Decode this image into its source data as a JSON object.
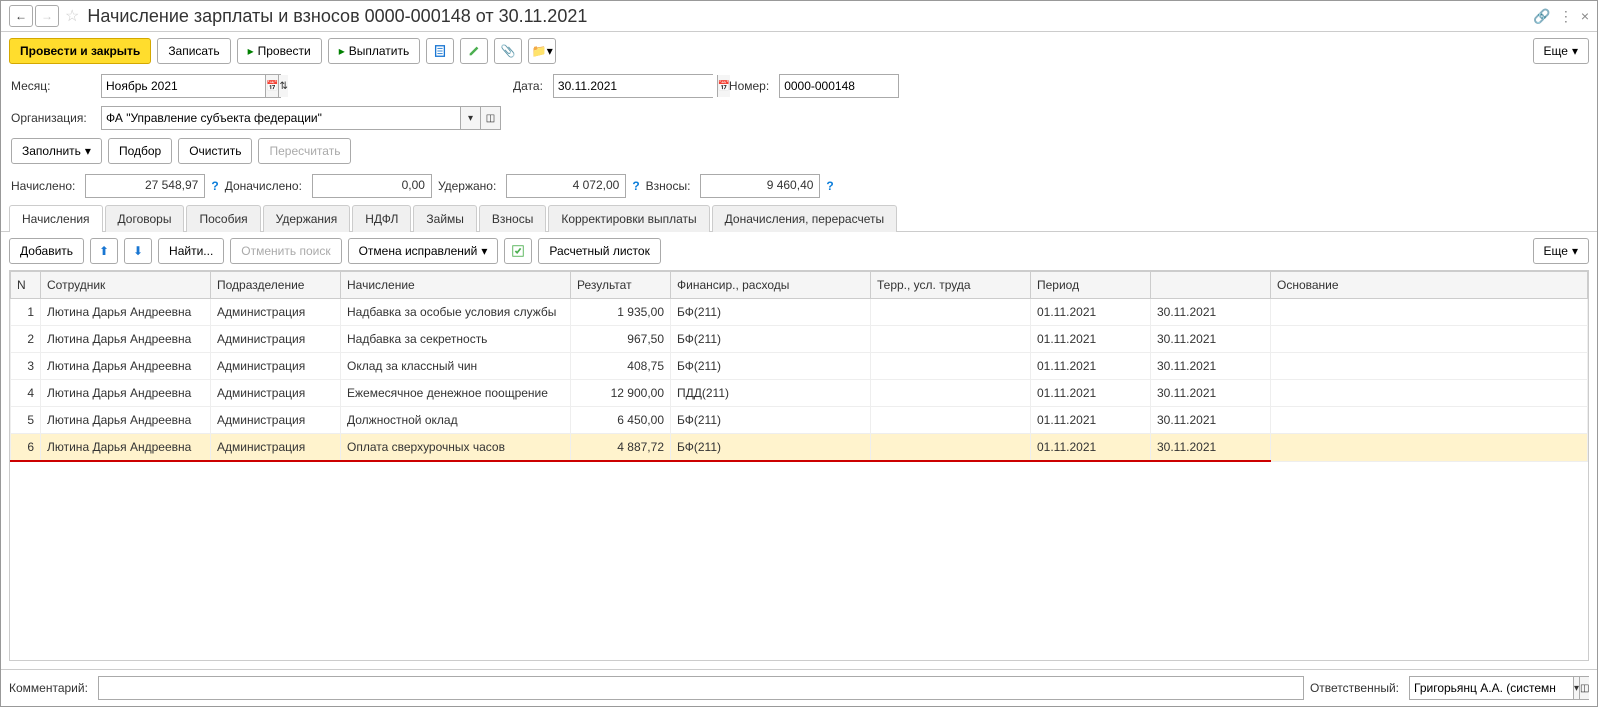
{
  "title": "Начисление зарплаты и взносов 0000-000148 от 30.11.2021",
  "toolbar": {
    "post_close": "Провести и закрыть",
    "save": "Записать",
    "post": "Провести",
    "pay": "Выплатить",
    "more": "Еще"
  },
  "form": {
    "month_label": "Месяц:",
    "month_value": "Ноябрь 2021",
    "date_label": "Дата:",
    "date_value": "30.11.2021",
    "number_label": "Номер:",
    "number_value": "0000-000148",
    "org_label": "Организация:",
    "org_value": "ФА \"Управление субъекта федерации\""
  },
  "actions": {
    "fill": "Заполнить",
    "pick": "Подбор",
    "clear": "Очистить",
    "recalc": "Пересчитать"
  },
  "summary": {
    "accrued_label": "Начислено:",
    "accrued_value": "27 548,97",
    "extra_label": "Доначислено:",
    "extra_value": "0,00",
    "withheld_label": "Удержано:",
    "withheld_value": "4 072,00",
    "contrib_label": "Взносы:",
    "contrib_value": "9 460,40"
  },
  "tabs": [
    "Начисления",
    "Договоры",
    "Пособия",
    "Удержания",
    "НДФЛ",
    "Займы",
    "Взносы",
    "Корректировки выплаты",
    "Доначисления, перерасчеты"
  ],
  "tab_toolbar": {
    "add": "Добавить",
    "find": "Найти...",
    "cancel_search": "Отменить поиск",
    "cancel_fixes": "Отмена исправлений",
    "payslip": "Расчетный листок",
    "more": "Еще"
  },
  "columns": [
    "N",
    "Сотрудник",
    "Подразделение",
    "Начисление",
    "Результат",
    "Финансир., расходы",
    "Терр., усл. труда",
    "Период",
    "",
    "Основание"
  ],
  "rows": [
    {
      "n": "1",
      "emp": "Лютина Дарья Андреевна",
      "dept": "Администрация",
      "accr": "Надбавка за особые условия службы",
      "res": "1 935,00",
      "fin": "БФ(211)",
      "terr": "",
      "p1": "01.11.2021",
      "p2": "30.11.2021",
      "base": ""
    },
    {
      "n": "2",
      "emp": "Лютина Дарья Андреевна",
      "dept": "Администрация",
      "accr": "Надбавка за секретность",
      "res": "967,50",
      "fin": "БФ(211)",
      "terr": "",
      "p1": "01.11.2021",
      "p2": "30.11.2021",
      "base": ""
    },
    {
      "n": "3",
      "emp": "Лютина Дарья Андреевна",
      "dept": "Администрация",
      "accr": "Оклад за классный чин",
      "res": "408,75",
      "fin": "БФ(211)",
      "terr": "",
      "p1": "01.11.2021",
      "p2": "30.11.2021",
      "base": ""
    },
    {
      "n": "4",
      "emp": "Лютина Дарья Андреевна",
      "dept": "Администрация",
      "accr": "Ежемесячное денежное поощрение",
      "res": "12 900,00",
      "fin": "ПДД(211)",
      "terr": "",
      "p1": "01.11.2021",
      "p2": "30.11.2021",
      "base": ""
    },
    {
      "n": "5",
      "emp": "Лютина Дарья Андреевна",
      "dept": "Администрация",
      "accr": "Должностной оклад",
      "res": "6 450,00",
      "fin": "БФ(211)",
      "terr": "",
      "p1": "01.11.2021",
      "p2": "30.11.2021",
      "base": ""
    },
    {
      "n": "6",
      "emp": "Лютина Дарья Андреевна",
      "dept": "Администрация",
      "accr": "Оплата сверхурочных часов",
      "res": "4 887,72",
      "fin": "БФ(211)",
      "terr": "",
      "p1": "01.11.2021",
      "p2": "30.11.2021",
      "base": ""
    }
  ],
  "footer": {
    "comment_label": "Комментарий:",
    "comment_value": "",
    "responsible_label": "Ответственный:",
    "responsible_value": "Григорьянц А.А. (системн"
  }
}
